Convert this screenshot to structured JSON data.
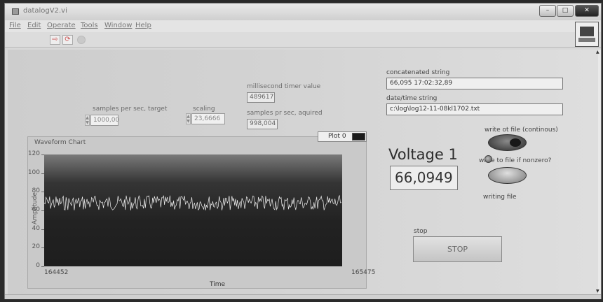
{
  "window": {
    "title": "datalogV2.vi",
    "buttons": {
      "minimize": "–",
      "maximize": "□",
      "close": "✕"
    }
  },
  "menu": [
    "File",
    "Edit",
    "Operate",
    "Tools",
    "Window",
    "Help"
  ],
  "toolbar": {
    "run_icon": "⇨",
    "run_cont_icon": "⟳",
    "abort_icon": "●"
  },
  "controls": {
    "samples_per_sec_target": {
      "label": "samples per sec, target",
      "value": "1000,00"
    },
    "scaling": {
      "label": "scaling",
      "value": "23,6666"
    },
    "millisecond_timer": {
      "label": "millisecond timer value",
      "value": "489617"
    },
    "samples_pr_sec_aquired": {
      "label": "samples pr sec, aquired",
      "value": "998,004"
    },
    "concatenated_string": {
      "label": "concatenated string",
      "value": "66,095  17:02:32,89"
    },
    "date_time_string": {
      "label": "date/time string",
      "value": "c:\\log\\log12-11-08kl1702.txt"
    }
  },
  "right_panel": {
    "voltage_label": "Voltage 1",
    "voltage_value": "66,0949",
    "write_continuous_label": "write ot file (continous)",
    "write_nonzero_label": "write to file if nonzero?",
    "writing_file_label": "writing file",
    "stop_label": "stop",
    "stop_button_text": "STOP"
  },
  "chart_data": {
    "type": "line",
    "title": "Waveform Chart",
    "legend": [
      "Plot 0"
    ],
    "xlabel": "Time",
    "ylabel": "Amplitude",
    "xlim": [
      164452,
      165475
    ],
    "ylim": [
      0,
      120
    ],
    "yticks": [
      0,
      20,
      40,
      60,
      80,
      100,
      120
    ],
    "xticks": [
      164452,
      165475
    ],
    "series": [
      {
        "name": "Plot 0",
        "band": [
          60,
          76
        ],
        "mean": 66
      }
    ],
    "colors": {
      "plot_line": "#f0f0f0",
      "plot_bg": "#222222"
    }
  }
}
